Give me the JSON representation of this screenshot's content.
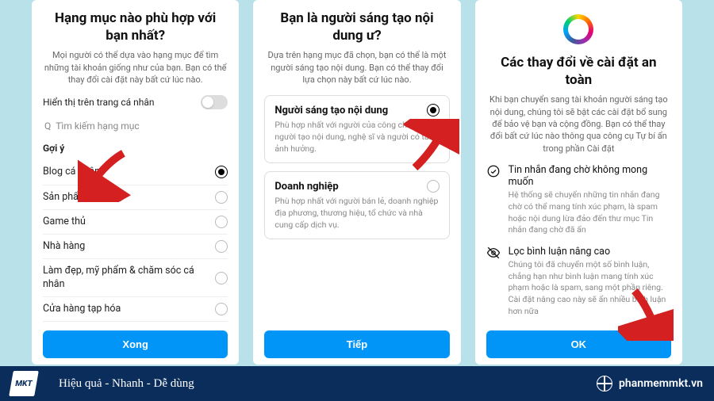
{
  "screen1": {
    "title": "Hạng mục nào phù hợp với bạn nhất?",
    "subtitle": "Mọi người có thể dựa vào hạng mục để tìm những tài khoản giống như của bạn. Bạn có thể thay đổi cài đặt này bất cứ lúc nào.",
    "toggle_label": "Hiển thị trên trang cá nhân",
    "search_placeholder": "Tìm kiếm hạng mục",
    "suggest_label": "Gợi ý",
    "categories": [
      {
        "label": "Blog cá nhân",
        "selected": true
      },
      {
        "label": "Sản phẩm/Dịch vụ",
        "selected": false
      },
      {
        "label": "Game thủ",
        "selected": false
      },
      {
        "label": "Nhà hàng",
        "selected": false
      },
      {
        "label": "Làm đẹp, mỹ phẩm & chăm sóc cá nhân",
        "selected": false
      },
      {
        "label": "Cửa hàng tạp hóa",
        "selected": false
      }
    ],
    "button": "Xong"
  },
  "screen2": {
    "title": "Bạn là người sáng tạo nội dung ư?",
    "subtitle": "Dựa trên hạng mục đã chọn, bạn có thể là một người sáng tạo nội dung. Bạn có thể thay đổi lựa chọn này bất cứ lúc nào.",
    "options": [
      {
        "title": "Người sáng tạo nội dung",
        "desc": "Phù hợp nhất với người của công chúng, người tạo nội dung, nghệ sĩ và người có tầm ảnh hưởng.",
        "selected": true
      },
      {
        "title": "Doanh nghiệp",
        "desc": "Phù hợp nhất với người bán lẻ, doanh nghiệp địa phương, thương hiệu, tổ chức và nhà cung cấp dịch vụ.",
        "selected": false
      }
    ],
    "button": "Tiếp"
  },
  "screen3": {
    "title": "Các thay đổi về cài đặt an toàn",
    "subtitle": "Khi bạn chuyển sang tài khoản người sáng tạo nội dung, chúng tôi sẽ bật các cài đặt bổ sung để bảo vệ bạn và cộng đồng. Bạn có thể thay đổi bất cứ lúc nào thông qua công cụ Tự bí ẩn trong phần Cài đặt",
    "items": [
      {
        "icon": "message",
        "title": "Tin nhắn đang chờ không mong muốn",
        "desc": "Hệ thống sẽ chuyển những tin nhắn đang chờ có thể mang tính xúc phạm, là spam hoặc nội dung lừa đảo đến thư mục Tin nhắn đang chờ đã ẩn"
      },
      {
        "icon": "eye-off",
        "title": "Lọc bình luận nâng cao",
        "desc": "Chúng tôi đã chuyển một số bình luận, chẳng hạn như bình luận mang tính xúc phạm hoặc là spam, sang một phần riêng. Cài đặt nâng cao này sẽ ẩn nhiều bình luận hơn nữa"
      }
    ],
    "button": "OK"
  },
  "footer": {
    "logo_text": "MKT",
    "tagline": "Hiệu quả - Nhanh - Dễ dùng",
    "site": "phanmemmkt.vn"
  }
}
